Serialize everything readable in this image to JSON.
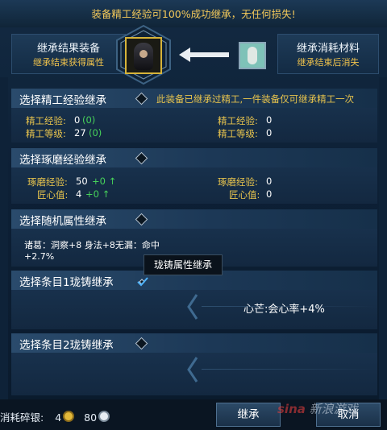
{
  "banner": "装备精工经验可100%成功继承，无任何损失!",
  "left_tag": {
    "title": "继承结果装备",
    "subtitle": "继承结束获得属性"
  },
  "right_tag": {
    "title": "继承消耗材料",
    "subtitle": "继承结束后消失"
  },
  "sections": {
    "refine": {
      "title": "选择精工经验继承",
      "note": "此装备已继承过精工,一件装备仅可继承精工一次",
      "left": {
        "exp_label": "精工经验:",
        "exp_value": "0",
        "exp_bonus": "(0)",
        "level_label": "精工等级:",
        "level_value": "27",
        "level_bonus": "(0)"
      },
      "right": {
        "exp_label": "精工经验:",
        "exp_value": "0",
        "level_label": "精工等级:",
        "level_value": "0"
      }
    },
    "polish": {
      "title": "选择琢磨经验继承",
      "left": {
        "exp_label": "琢磨经验:",
        "exp_value": "50",
        "exp_bonus": "+0 ↑",
        "heart_label": "匠心值:",
        "heart_value": "4",
        "heart_bonus": "+0 ↑"
      },
      "right": {
        "exp_label": "琢磨经验:",
        "exp_value": "0",
        "heart_label": "匠心值:",
        "heart_value": "0"
      }
    },
    "random": {
      "title": "选择随机属性继承",
      "line1": "诸葛：洞察+8 身法+8无漏：命中",
      "line2": "+2.7%"
    },
    "slot1": {
      "title": "选择条目1珑铸继承",
      "value": "心芒:会心率+4%"
    },
    "slot2": {
      "title": "选择条目2珑铸继承"
    }
  },
  "tooltip": "珑铸属性继承",
  "footer": {
    "cost_label": "消耗碎银:",
    "cost_gold": "4",
    "cost_silver": "80",
    "inherit_button": "继承",
    "cancel_button": "取消"
  },
  "watermark": {
    "brand": "sina",
    "text": "新浪游戏"
  },
  "colors": {
    "gold": "#e8c44d",
    "green": "#47d25a",
    "accent_border": "#d7b43a"
  }
}
